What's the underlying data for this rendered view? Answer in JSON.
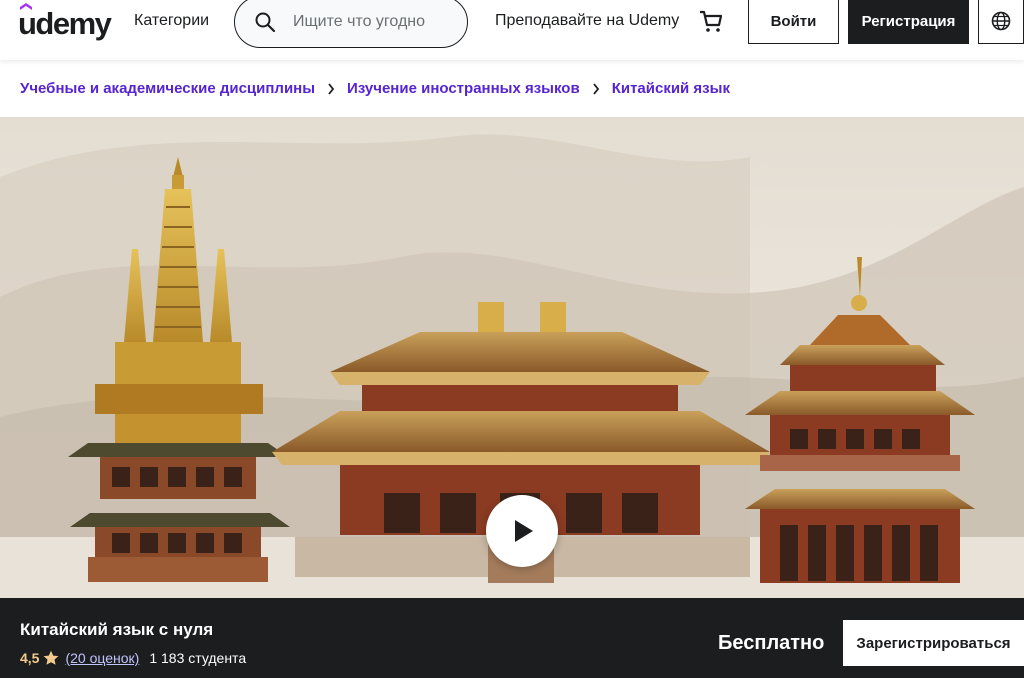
{
  "header": {
    "logo": "udemy",
    "categories_label": "Категории",
    "search_placeholder": "Ищите что угодно",
    "teach_label": "Преподавайте на Udemy",
    "login_label": "Войти",
    "signup_label": "Регистрация",
    "icons": {
      "search": "search-icon",
      "cart": "cart-icon",
      "language": "globe-icon"
    }
  },
  "breadcrumb": [
    "Учебные и академические дисциплины",
    "Изучение иностранных языков",
    "Китайский язык"
  ],
  "hero": {
    "play_icon": "play-icon"
  },
  "course": {
    "title": "Китайский язык с нуля",
    "rating": "4,5",
    "ratings_count": "(20 оценок)",
    "students": "1 183 студента",
    "price": "Бесплатно",
    "enroll_label": "Зарегистрироваться"
  },
  "colors": {
    "accent": "#5624d0",
    "dark": "#1c1d1f",
    "star": "#f3ca8c",
    "link_light": "#c0c4fc"
  }
}
